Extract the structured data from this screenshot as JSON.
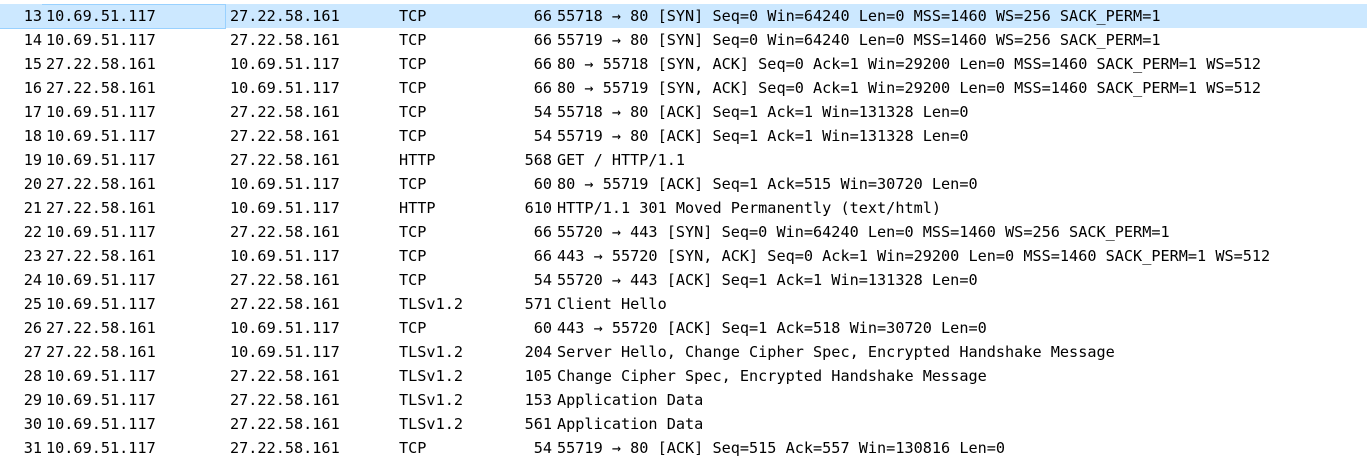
{
  "packets": [
    {
      "no": "13",
      "src": "10.69.51.117",
      "dst": "27.22.58.161",
      "proto": "TCP",
      "len": "66",
      "info": "55718 → 80 [SYN] Seq=0 Win=64240 Len=0 MSS=1460 WS=256 SACK_PERM=1",
      "selected": true
    },
    {
      "no": "14",
      "src": "10.69.51.117",
      "dst": "27.22.58.161",
      "proto": "TCP",
      "len": "66",
      "info": "55719 → 80 [SYN] Seq=0 Win=64240 Len=0 MSS=1460 WS=256 SACK_PERM=1"
    },
    {
      "no": "15",
      "src": "27.22.58.161",
      "dst": "10.69.51.117",
      "proto": "TCP",
      "len": "66",
      "info": "80 → 55718 [SYN, ACK] Seq=0 Ack=1 Win=29200 Len=0 MSS=1460 SACK_PERM=1 WS=512"
    },
    {
      "no": "16",
      "src": "27.22.58.161",
      "dst": "10.69.51.117",
      "proto": "TCP",
      "len": "66",
      "info": "80 → 55719 [SYN, ACK] Seq=0 Ack=1 Win=29200 Len=0 MSS=1460 SACK_PERM=1 WS=512"
    },
    {
      "no": "17",
      "src": "10.69.51.117",
      "dst": "27.22.58.161",
      "proto": "TCP",
      "len": "54",
      "info": "55718 → 80 [ACK] Seq=1 Ack=1 Win=131328 Len=0"
    },
    {
      "no": "18",
      "src": "10.69.51.117",
      "dst": "27.22.58.161",
      "proto": "TCP",
      "len": "54",
      "info": "55719 → 80 [ACK] Seq=1 Ack=1 Win=131328 Len=0"
    },
    {
      "no": "19",
      "src": "10.69.51.117",
      "dst": "27.22.58.161",
      "proto": "HTTP",
      "len": "568",
      "info": "GET / HTTP/1.1"
    },
    {
      "no": "20",
      "src": "27.22.58.161",
      "dst": "10.69.51.117",
      "proto": "TCP",
      "len": "60",
      "info": "80 → 55719 [ACK] Seq=1 Ack=515 Win=30720 Len=0"
    },
    {
      "no": "21",
      "src": "27.22.58.161",
      "dst": "10.69.51.117",
      "proto": "HTTP",
      "len": "610",
      "info": "HTTP/1.1 301 Moved Permanently  (text/html)"
    },
    {
      "no": "22",
      "src": "10.69.51.117",
      "dst": "27.22.58.161",
      "proto": "TCP",
      "len": "66",
      "info": "55720 → 443 [SYN] Seq=0 Win=64240 Len=0 MSS=1460 WS=256 SACK_PERM=1"
    },
    {
      "no": "23",
      "src": "27.22.58.161",
      "dst": "10.69.51.117",
      "proto": "TCP",
      "len": "66",
      "info": "443 → 55720 [SYN, ACK] Seq=0 Ack=1 Win=29200 Len=0 MSS=1460 SACK_PERM=1 WS=512"
    },
    {
      "no": "24",
      "src": "10.69.51.117",
      "dst": "27.22.58.161",
      "proto": "TCP",
      "len": "54",
      "info": "55720 → 443 [ACK] Seq=1 Ack=1 Win=131328 Len=0"
    },
    {
      "no": "25",
      "src": "10.69.51.117",
      "dst": "27.22.58.161",
      "proto": "TLSv1.2",
      "len": "571",
      "info": "Client Hello"
    },
    {
      "no": "26",
      "src": "27.22.58.161",
      "dst": "10.69.51.117",
      "proto": "TCP",
      "len": "60",
      "info": "443 → 55720 [ACK] Seq=1 Ack=518 Win=30720 Len=0"
    },
    {
      "no": "27",
      "src": "27.22.58.161",
      "dst": "10.69.51.117",
      "proto": "TLSv1.2",
      "len": "204",
      "info": "Server Hello, Change Cipher Spec, Encrypted Handshake Message"
    },
    {
      "no": "28",
      "src": "10.69.51.117",
      "dst": "27.22.58.161",
      "proto": "TLSv1.2",
      "len": "105",
      "info": "Change Cipher Spec, Encrypted Handshake Message"
    },
    {
      "no": "29",
      "src": "10.69.51.117",
      "dst": "27.22.58.161",
      "proto": "TLSv1.2",
      "len": "153",
      "info": "Application Data"
    },
    {
      "no": "30",
      "src": "10.69.51.117",
      "dst": "27.22.58.161",
      "proto": "TLSv1.2",
      "len": "561",
      "info": "Application Data"
    },
    {
      "no": "31",
      "src": "10.69.51.117",
      "dst": "27.22.58.161",
      "proto": "TCP",
      "len": "54",
      "info": "55719 → 80 [ACK] Seq=515 Ack=557 Win=130816 Len=0"
    }
  ],
  "colors": {
    "selected_row_bg": "#cce8ff",
    "selected_row_border": "#99d1ff",
    "text": "#000000",
    "background": "#ffffff"
  }
}
